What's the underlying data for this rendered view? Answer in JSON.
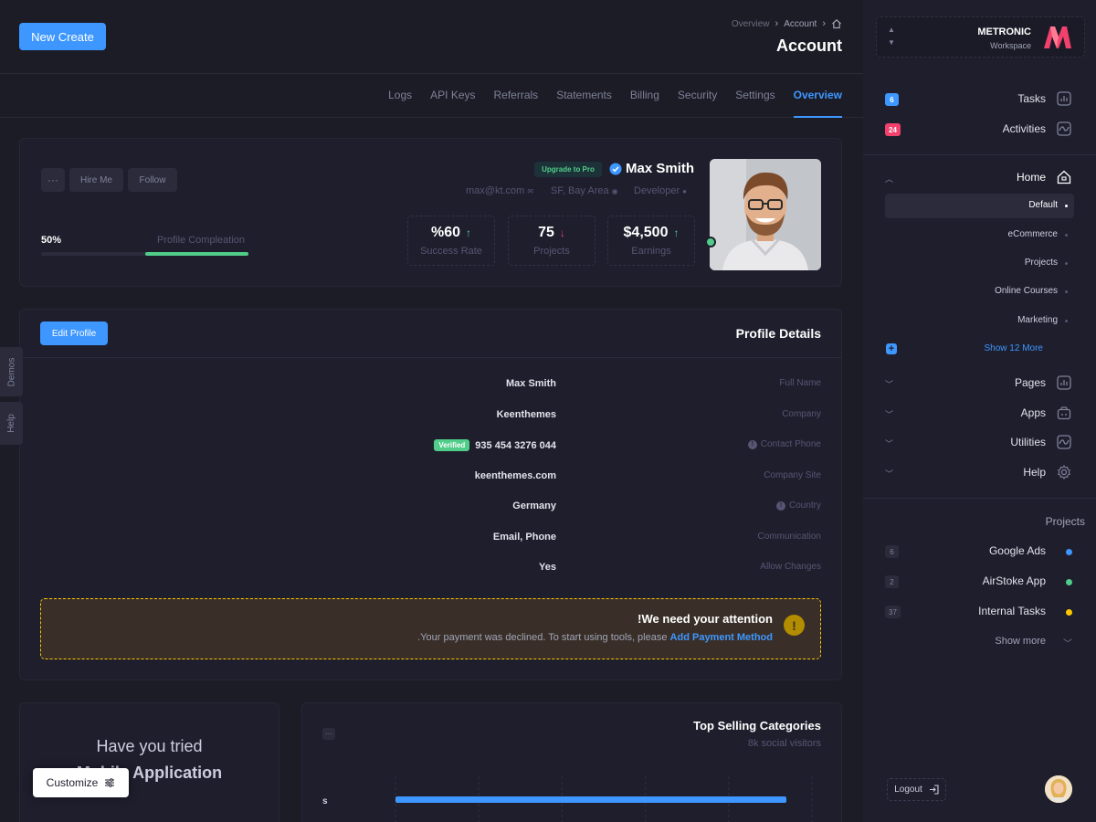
{
  "topbar": {
    "new_create_label": "New Create",
    "breadcrumb": [
      "Overview",
      "Account"
    ],
    "page_title": "Account"
  },
  "tabs": [
    "Logs",
    "API Keys",
    "Referrals",
    "Statements",
    "Billing",
    "Security",
    "Settings",
    "Overview"
  ],
  "active_tab": "Overview",
  "profile": {
    "dots_label": "···",
    "hire_label": "Hire Me",
    "follow_label": "Follow",
    "upgrade_label": "Upgrade to Pro",
    "name": "Max Smith",
    "email": "max@kt.com",
    "location": "SF, Bay Area",
    "role": "Developer",
    "completion_percent": "50%",
    "completion_value": 50,
    "completion_label": "Profile Compleation",
    "stats": [
      {
        "value": "%60",
        "label": "Success Rate",
        "trend": "up"
      },
      {
        "value": "75",
        "label": "Projects",
        "trend": "down"
      },
      {
        "value": "$4,500",
        "label": "Earnings",
        "trend": "up"
      }
    ]
  },
  "details": {
    "edit_label": "Edit Profile",
    "title": "Profile Details",
    "verified_badge": "Verified",
    "rows": [
      {
        "label": "Full Name",
        "value": "Max Smith"
      },
      {
        "label": "Company",
        "value": "Keenthemes"
      },
      {
        "label": "Contact Phone",
        "value": "935 454 3276 044"
      },
      {
        "label": "Company Site",
        "value": "keenthemes.com"
      },
      {
        "label": "Country",
        "value": "Germany"
      },
      {
        "label": "Communication",
        "value": "Email, Phone"
      },
      {
        "label": "Allow Changes",
        "value": "Yes"
      }
    ]
  },
  "alert": {
    "title": "!We need your attention",
    "text": ".Your payment was declined. To start using tools, please",
    "link": "Add Payment Method"
  },
  "promo": {
    "line1": "Have you tried",
    "line2": "Mobile Application"
  },
  "chart_data": {
    "type": "bar",
    "title": "Top Selling Categories",
    "subtitle": "8k social visitors",
    "dots_label": "···",
    "categories": [
      "s"
    ],
    "values": [
      100
    ],
    "xlim": [
      0,
      100
    ],
    "color": "#3e97ff"
  },
  "customize_label": "Customize",
  "side_tabs": {
    "demos": "Demos",
    "help": "Help"
  },
  "sidebar": {
    "workspace_name": "METRONIC",
    "workspace_sub": "Workspace",
    "tasks": {
      "label": "Tasks",
      "count": "6"
    },
    "activities": {
      "label": "Activities",
      "count": "24"
    },
    "home": {
      "label": "Home"
    },
    "home_sub": [
      "Default",
      "eCommerce",
      "Projects",
      "Online Courses",
      "Marketing"
    ],
    "show_more_home": "Show 12 More",
    "pages": "Pages",
    "apps": "Apps",
    "utilities": "Utilities",
    "help": "Help",
    "projects_heading": "Projects",
    "projects": [
      {
        "count": "6",
        "label": "Google Ads",
        "color": "#3e97ff"
      },
      {
        "count": "2",
        "label": "AirStoke App",
        "color": "#50cd89"
      },
      {
        "count": "37",
        "label": "Internal Tasks",
        "color": "#ffc700"
      }
    ],
    "show_more": "Show more",
    "logout": "Logout"
  },
  "colors": {
    "primary": "#3e97ff",
    "success": "#50cd89",
    "danger": "#f1416c",
    "warning": "#ffc700"
  }
}
